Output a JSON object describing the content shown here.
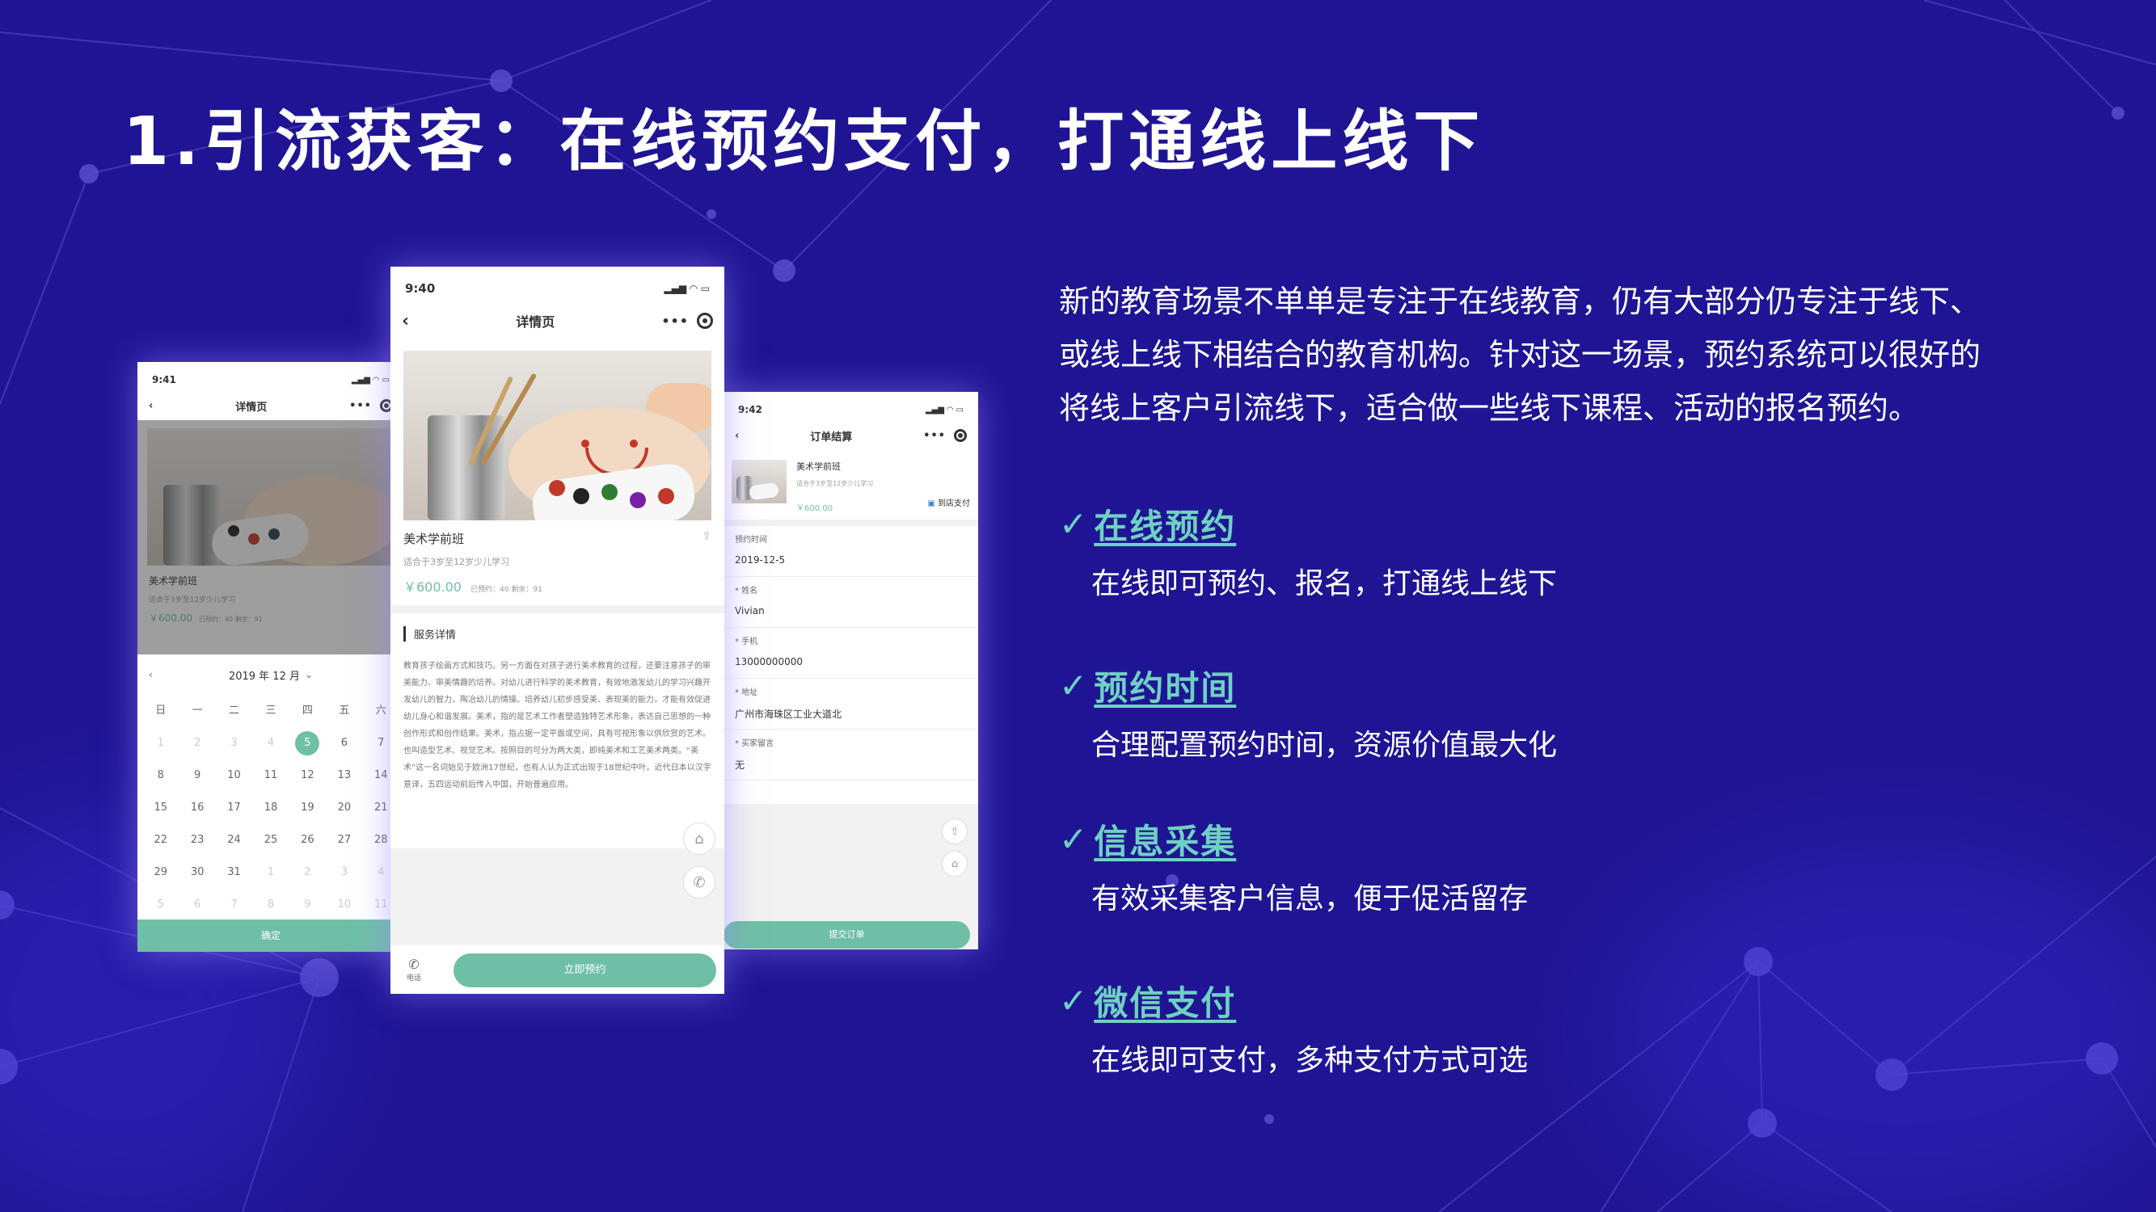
{
  "title": "1.引流获客：在线预约支付，打通线上线下",
  "intro": "新的教育场景不单单是专注于在线教育，仍有大部分仍专注于线下、或线上线下相结合的教育机构。针对这一场景，预约系统可以很好的将线上客户引流线下，适合做一些线下课程、活动的报名预约。",
  "features": [
    {
      "title": "在线预约",
      "desc": "在线即可预约、报名，打通线上线下"
    },
    {
      "title": "预约时间",
      "desc": "合理配置预约时间，资源价值最大化"
    },
    {
      "title": "信息采集",
      "desc": "有效采集客户信息，便于促活留存"
    },
    {
      "title": "微信支付",
      "desc": "在线即可支付，多种支付方式可选"
    }
  ],
  "colors": {
    "accent": "#6fd1c2",
    "background": "#1f1594",
    "button": "#6fbfa6"
  },
  "phone_left": {
    "time": "9:41",
    "nav_title": "详情页",
    "course_name": "美术学前班",
    "course_sub": "适合于3岁至12岁少儿学习",
    "price": "￥600.00",
    "stats": "已预约：40  剩余：91",
    "month": "2019 年 12 月",
    "weekdays": [
      "日",
      "一",
      "二",
      "三",
      "四",
      "五",
      "六"
    ],
    "days": [
      "1",
      "2",
      "3",
      "4",
      "5",
      "6",
      "7",
      "8",
      "9",
      "10",
      "11",
      "12",
      "13",
      "14",
      "15",
      "16",
      "17",
      "18",
      "19",
      "20",
      "21",
      "22",
      "23",
      "24",
      "25",
      "26",
      "27",
      "28",
      "29",
      "30",
      "31",
      "1",
      "2",
      "3",
      "4",
      "5",
      "6",
      "7",
      "8",
      "9",
      "10",
      "11"
    ],
    "confirm": "确定"
  },
  "phone_center": {
    "time": "9:40",
    "nav_title": "详情页",
    "course_name": "美术学前班",
    "course_sub": "适合于3岁至12岁少儿学习",
    "price": "￥600.00",
    "stats": "已预约：40  剩余：91",
    "section_title": "服务详情",
    "detail": "教育孩子绘画方式和技巧。另一方面在对孩子进行美术教育的过程，还要注意孩子的审美能力、审美情趣的培养。对幼儿进行科学的美术教育，有效地激发幼儿的学习兴趣开发幼儿的智力，陶冶幼儿的情操。培养幼儿初步感受美、表现美的能力，才能有效促进幼儿身心和谐发展。美术，指的是艺术工作者塑造独特艺术形象，表达自己思想的一种创作形式和创作结果。美术，指占据一定平面或空间，具有可视形象以供欣赏的艺术。也叫造型艺术、视觉艺术。按照目的可分为两大类，即纯美术和工艺美术两类。“美术”这一名词始见于欧洲17世纪，也有人认为正式出现于18世纪中叶。近代日本以汉字意译，五四运动前后传入中国，开始普遍应用。",
    "phone_label": "电话",
    "book_button": "立即预约"
  },
  "phone_right": {
    "time": "9:42",
    "nav_title": "订单结算",
    "course_name": "美术学前班",
    "course_sub": "适合于3岁至12岁少儿学习",
    "price": "￥600.00",
    "pay_method": "到店支付",
    "fields": [
      {
        "label": "预约时间",
        "value": "2019-12-5"
      },
      {
        "label": "* 姓名",
        "value": "Vivian"
      },
      {
        "label": "* 手机",
        "value": "13000000000"
      },
      {
        "label": "* 地址",
        "value": "广州市海珠区工业大道北"
      },
      {
        "label": "* 买家留言",
        "value": "无"
      }
    ],
    "submit": "提交订单"
  }
}
